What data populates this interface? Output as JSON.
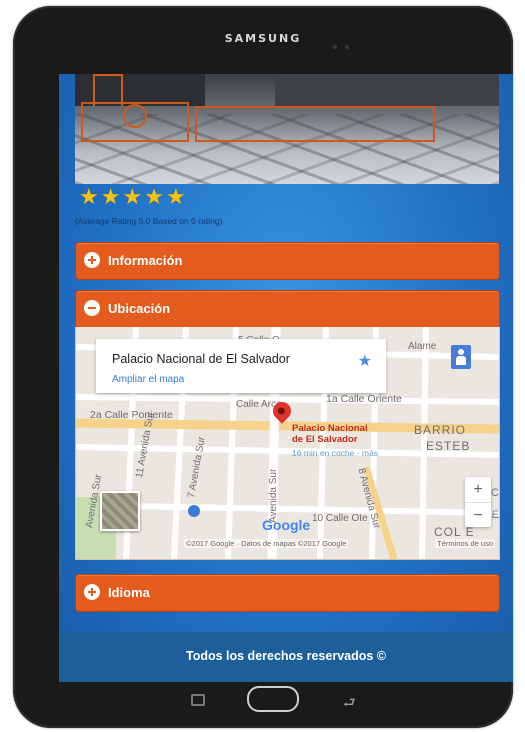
{
  "device": {
    "brand": "SAMSUNG"
  },
  "hero": {
    "alt": "game screenshot with touch controls"
  },
  "rating": {
    "stars": 5,
    "max_stars": 5,
    "text": "(Average Rating 5.0 Based on 0 rating)"
  },
  "sections": {
    "informacion": {
      "label": "Información",
      "expanded": false
    },
    "ubicacion": {
      "label": "Ubicación",
      "expanded": true
    },
    "idioma": {
      "label": "Idioma",
      "expanded": false
    }
  },
  "map": {
    "place_title": "Palacio Nacional de El Salvador",
    "enlarge_link": "Ampliar el mapa",
    "pin_label_1": "Palacio Nacional",
    "pin_label_2": "de El Salvador",
    "pin_sub": "16 min en coche · más",
    "streets": {
      "s1": "5 Calle O",
      "s2": "2a Calle Poniente",
      "s3": "Calle Arce",
      "s4": "1a Calle Oriente",
      "s5": "BARRIO",
      "s6": "ESTEB",
      "s7": "11 Avenida Sur",
      "s8": "7 Avenida Sur",
      "s9": "Avenida Sur",
      "s10": "8 Avenida Sur",
      "s11": "10 Calle Ote",
      "s12": "COL E",
      "s13": "Alame",
      "s14": "Avenida Sur",
      "s15": "C",
      "s16": "E"
    },
    "zoom_in": "+",
    "zoom_out": "−",
    "google_logo": "Google",
    "copyright": "©2017 Google · Datos de mapas ©2017 Google",
    "terms": "Términos de uso"
  },
  "footer": {
    "text": "Todos los derechos reservados ©"
  },
  "colors": {
    "accent_orange": "#e35c1d",
    "page_blue": "#2a82d6",
    "footer_blue": "#1c5f9a",
    "star_gold": "#f5c315"
  }
}
